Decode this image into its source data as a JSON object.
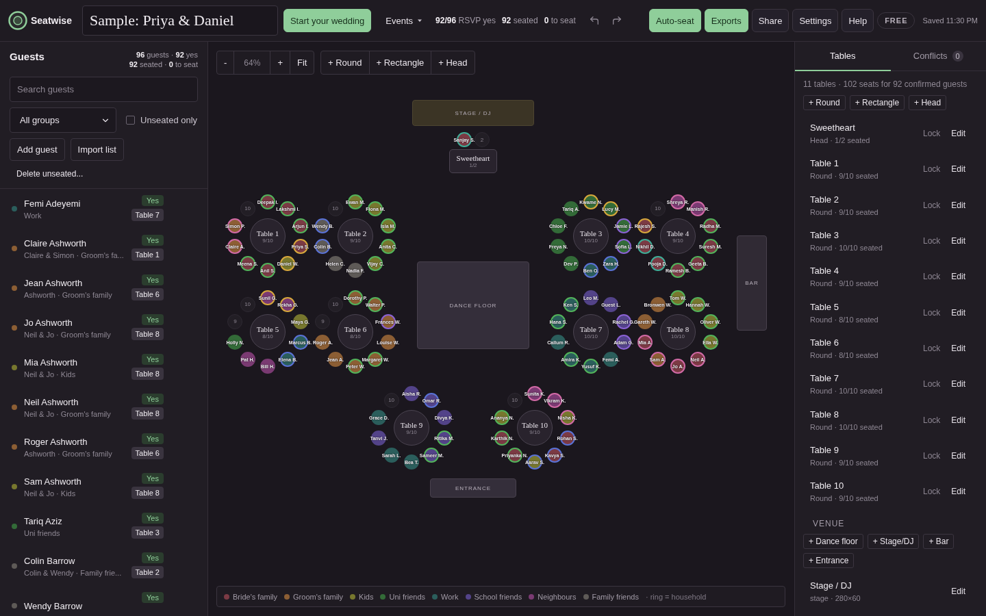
{
  "app": {
    "name": "Seatwise"
  },
  "title": "Sample: Priya & Daniel",
  "top_bar": {
    "start": "Start your wedding",
    "events": "Events",
    "stats": [
      "**92/96** RSVP yes",
      "**92** seated",
      "**0** to seat"
    ],
    "actions": [
      {
        "label": "Auto-seat",
        "kind": "primary"
      },
      {
        "label": "Exports",
        "kind": "primary"
      },
      {
        "label": "Share",
        "kind": "secondary"
      },
      {
        "label": "Settings",
        "kind": "secondary"
      },
      {
        "label": "Help",
        "kind": "secondary"
      }
    ],
    "plan": "FREE",
    "saved": "Saved 11:30 PM"
  },
  "guests_panel": {
    "title": "Guests",
    "stats": [
      "**96** guests · **92** yes",
      "**92** seated · **0** to seat"
    ],
    "search": {
      "placeholder": "Search guests"
    },
    "group_filter": "All groups",
    "unseated_only": {
      "label": "Unseated only",
      "checked": false
    },
    "buttons": [
      "Add guest",
      "Import list"
    ],
    "delete": "Delete unseated...",
    "guests": [
      {
        "name": "Femi Adeyemi",
        "detail": "Work",
        "rsvp": "Yes",
        "table": "Table 7",
        "color": "#2b5e5c"
      },
      {
        "name": "Claire Ashworth",
        "detail": "Claire & Simon · Groom's fa...",
        "rsvp": "Yes",
        "table": "Table 1",
        "color": "#8c5e34"
      },
      {
        "name": "Jean Ashworth",
        "detail": "Ashworth · Groom's family",
        "rsvp": "Yes",
        "table": "Table 6",
        "color": "#8c5e34"
      },
      {
        "name": "Jo Ashworth",
        "detail": "Neil & Jo · Groom's family",
        "rsvp": "Yes",
        "table": "Table 8",
        "color": "#8c5e34"
      },
      {
        "name": "Mia Ashworth",
        "detail": "Neil & Jo · Kids",
        "rsvp": "Yes",
        "table": "Table 8",
        "color": "#77772e"
      },
      {
        "name": "Neil Ashworth",
        "detail": "Neil & Jo · Groom's family",
        "rsvp": "Yes",
        "table": "Table 8",
        "color": "#8c5e34"
      },
      {
        "name": "Roger Ashworth",
        "detail": "Ashworth · Groom's family",
        "rsvp": "Yes",
        "table": "Table 6",
        "color": "#8c5e34"
      },
      {
        "name": "Sam Ashworth",
        "detail": "Neil & Jo · Kids",
        "rsvp": "Yes",
        "table": "Table 8",
        "color": "#77772e"
      },
      {
        "name": "Tariq Aziz",
        "detail": "Uni friends",
        "rsvp": "Yes",
        "table": "Table 3",
        "color": "#336b38"
      },
      {
        "name": "Colin Barrow",
        "detail": "Colin & Wendy · Family frie...",
        "rsvp": "Yes",
        "table": "Table 2",
        "color": "#5e5a57"
      },
      {
        "name": "Wendy Barrow",
        "rsvp": "Yes",
        "color": "#5e5a57"
      }
    ]
  },
  "canvas": {
    "zoom": {
      "minus": "-",
      "level_text": "64%",
      "plus": "+",
      "fit": "Fit"
    },
    "add_buttons": [
      "+ Round",
      "+ Rectangle",
      "+ Head"
    ],
    "venue": [
      {
        "label": "STAGE / DJ",
        "kind": "stage"
      },
      {
        "label": "DANCE FLOOR",
        "kind": "dance_floor"
      },
      {
        "label": "BAR",
        "kind": "bar"
      },
      {
        "label": "ENTRANCE",
        "kind": "entrance"
      }
    ],
    "tables": [
      {
        "name": "Sweetheart",
        "count": "1/2",
        "kind": "head",
        "seats": [
          {
            "name": "Sanjay S.",
            "color": "#7b3a44",
            "ring": {
              "color": "#3fae98"
            }
          },
          {
            "name": "2",
            "kind": "empty"
          }
        ]
      },
      {
        "name": "Table 1",
        "count": "9/10",
        "kind": "round",
        "seats": [
          {
            "name": "Deepak I.",
            "color": "#7b3a44",
            "ring": {
              "color": "#52b35a"
            }
          },
          {
            "name": "10",
            "kind": "empty"
          },
          {
            "name": "Lakshmi I.",
            "color": "#7b3a44",
            "ring": {
              "color": "#52b35a"
            }
          },
          {
            "name": "Simon P.",
            "color": "#8c5e34",
            "ring": {
              "color": "#d26aa6"
            }
          },
          {
            "name": "Arjun I.",
            "color": "#7b3a44",
            "ring": {
              "color": "#52b35a"
            }
          },
          {
            "name": "Claire A.",
            "color": "#8c5e34",
            "ring": {
              "color": "#d26aa6"
            }
          },
          {
            "name": "Priya S.",
            "color": "#7b3a44",
            "ring": {
              "color": "#d7a83c"
            }
          },
          {
            "name": "Meena S.",
            "color": "#7b3a44",
            "ring": {
              "color": "#52b35a"
            }
          },
          {
            "name": "Daniel W.",
            "color": "#77772e",
            "ring": {
              "color": "#d7a83c"
            }
          },
          {
            "name": "Anil S.",
            "color": "#7b3a44",
            "ring": {
              "color": "#52b35a"
            }
          }
        ]
      },
      {
        "name": "Table 2",
        "count": "9/10",
        "kind": "round",
        "seats": [
          {
            "name": "Ewan M.",
            "color": "#77772e",
            "ring": {
              "color": "#52b35a"
            }
          },
          {
            "name": "10",
            "kind": "empty"
          },
          {
            "name": "Fiona M.",
            "color": "#77772e",
            "ring": {
              "color": "#52b35a"
            }
          },
          {
            "name": "Wendy B.",
            "color": "#5e5a57",
            "ring": {
              "color": "#5a72d6"
            }
          },
          {
            "name": "Isla M.",
            "color": "#77772e",
            "ring": {
              "color": "#52b35a"
            }
          },
          {
            "name": "Colin B.",
            "color": "#5e5a57",
            "ring": {
              "color": "#5a72d6"
            }
          },
          {
            "name": "Anita C.",
            "color": "#77772e",
            "ring": {
              "color": "#52b35a"
            }
          },
          {
            "name": "Helen C.",
            "color": "#5e5a57"
          },
          {
            "name": "Vijay C.",
            "color": "#77772e",
            "ring": {
              "color": "#52b35a"
            }
          },
          {
            "name": "Nadia F.",
            "color": "#5e5a57"
          }
        ]
      },
      {
        "name": "Table 3",
        "count": "10/10",
        "kind": "round",
        "seats": [
          {
            "name": "Kwame N.",
            "color": "#336b38",
            "ring": {
              "color": "#d7a83c"
            }
          },
          {
            "name": "Tariq A.",
            "color": "#336b38"
          },
          {
            "name": "Lucy M.",
            "color": "#336b38",
            "ring": {
              "color": "#d7a83c"
            }
          },
          {
            "name": "Chloe F.",
            "color": "#336b38"
          },
          {
            "name": "Jamie L.",
            "color": "#336b38",
            "ring": {
              "color": "#8b62d4"
            }
          },
          {
            "name": "Freya N.",
            "color": "#336b38"
          },
          {
            "name": "Sofia L.",
            "color": "#336b38",
            "ring": {
              "color": "#8b62d4"
            }
          },
          {
            "name": "Dev P.",
            "color": "#336b38"
          },
          {
            "name": "Zara H.",
            "color": "#2b5e5c",
            "ring": {
              "color": "#5a72d6"
            }
          },
          {
            "name": "Ben O.",
            "color": "#2b5e5c",
            "ring": {
              "color": "#5a72d6"
            }
          }
        ]
      },
      {
        "name": "Table 4",
        "count": "9/10",
        "kind": "round",
        "seats": [
          {
            "name": "Shreya R.",
            "color": "#7a3a72",
            "ring": {
              "color": "#d26aa6"
            }
          },
          {
            "name": "10",
            "kind": "empty"
          },
          {
            "name": "Manish R.",
            "color": "#7a3a72",
            "ring": {
              "color": "#d26aa6"
            }
          },
          {
            "name": "Rajesh S.",
            "color": "#7b3a44",
            "ring": {
              "color": "#d7a83c"
            }
          },
          {
            "name": "Radha M.",
            "color": "#7b3a44",
            "ring": {
              "color": "#52b35a"
            }
          },
          {
            "name": "Nikhil D.",
            "color": "#7b3a44",
            "ring": {
              "color": "#3fae98"
            }
          },
          {
            "name": "Suresh M.",
            "color": "#7b3a44",
            "ring": {
              "color": "#52b35a"
            }
          },
          {
            "name": "Pooja D.",
            "color": "#7b3a44",
            "ring": {
              "color": "#3fae98"
            }
          },
          {
            "name": "Geeta B.",
            "color": "#7b3a44",
            "ring": {
              "color": "#52b35a"
            }
          },
          {
            "name": "Ramesh B.",
            "color": "#7b3a44",
            "ring": {
              "color": "#52b35a"
            }
          }
        ]
      },
      {
        "name": "Table 5",
        "count": "8/10",
        "kind": "round",
        "seats": [
          {
            "name": "Sunil G.",
            "color": "#7a3a72",
            "ring": {
              "color": "#d7a83c"
            }
          },
          {
            "name": "10",
            "kind": "empty"
          },
          {
            "name": "Rekha G.",
            "color": "#7a3a72",
            "ring": {
              "color": "#d7a83c"
            }
          },
          {
            "name": "9",
            "kind": "empty"
          },
          {
            "name": "Maya G.",
            "color": "#77772e"
          },
          {
            "name": "Holly N.",
            "color": "#336b38"
          },
          {
            "name": "Marcus B.",
            "color": "#2b5e5c",
            "ring": {
              "color": "#5a72d6"
            }
          },
          {
            "name": "Pat H.",
            "color": "#7a3a72"
          },
          {
            "name": "Elena B.",
            "color": "#2b5e5c",
            "ring": {
              "color": "#5a72d6"
            }
          },
          {
            "name": "Bill H.",
            "color": "#7a3a72"
          }
        ]
      },
      {
        "name": "Table 6",
        "count": "8/10",
        "kind": "round",
        "seats": [
          {
            "name": "Dorothy P.",
            "color": "#8c5e34",
            "ring": {
              "color": "#52b35a"
            }
          },
          {
            "name": "10",
            "kind": "empty"
          },
          {
            "name": "Walter P.",
            "color": "#8c5e34",
            "ring": {
              "color": "#52b35a"
            }
          },
          {
            "name": "9",
            "kind": "empty"
          },
          {
            "name": "Frances W.",
            "color": "#8c5e34",
            "ring": {
              "color": "#8b62d4"
            }
          },
          {
            "name": "Roger A.",
            "color": "#8c5e34"
          },
          {
            "name": "Louise W.",
            "color": "#8c5e34"
          },
          {
            "name": "Jean A.",
            "color": "#8c5e34"
          },
          {
            "name": "Margaret W.",
            "color": "#8c5e34",
            "ring": {
              "color": "#52b35a"
            }
          },
          {
            "name": "Peter W.",
            "color": "#8c5e34",
            "ring": {
              "color": "#52b35a"
            }
          }
        ]
      },
      {
        "name": "Table 7",
        "count": "10/10",
        "kind": "round",
        "seats": [
          {
            "name": "Leo M.",
            "color": "#534389"
          },
          {
            "name": "Ken S.",
            "color": "#2b5e5c",
            "ring": {
              "color": "#52b35a"
            }
          },
          {
            "name": "Guest L.",
            "color": "#534389"
          },
          {
            "name": "Hana S.",
            "color": "#2b5e5c",
            "ring": {
              "color": "#52b35a"
            }
          },
          {
            "name": "Rachel G.",
            "color": "#534389",
            "ring": {
              "color": "#8b62d4"
            }
          },
          {
            "name": "Callum R.",
            "color": "#2b5e5c"
          },
          {
            "name": "Adam G.",
            "color": "#534389",
            "ring": {
              "color": "#8b62d4"
            }
          },
          {
            "name": "Amira K.",
            "color": "#2b5e5c",
            "ring": {
              "color": "#52b35a"
            }
          },
          {
            "name": "Femi A.",
            "color": "#2b5e5c"
          },
          {
            "name": "Yusuf K.",
            "color": "#2b5e5c",
            "ring": {
              "color": "#52b35a"
            }
          }
        ]
      },
      {
        "name": "Table 8",
        "count": "10/10",
        "kind": "round",
        "seats": [
          {
            "name": "Tom W.",
            "color": "#77772e",
            "ring": {
              "color": "#52b35a"
            }
          },
          {
            "name": "Bronwen W.",
            "color": "#8c5e34"
          },
          {
            "name": "Hannah W.",
            "color": "#77772e",
            "ring": {
              "color": "#52b35a"
            }
          },
          {
            "name": "Gareth W.",
            "color": "#8c5e34"
          },
          {
            "name": "Oliver W.",
            "color": "#77772e",
            "ring": {
              "color": "#52b35a"
            }
          },
          {
            "name": "Mia A.",
            "color": "#7b3a44",
            "ring": {
              "color": "#d26aa6"
            }
          },
          {
            "name": "Ella W.",
            "color": "#77772e",
            "ring": {
              "color": "#52b35a"
            }
          },
          {
            "name": "Sam A.",
            "color": "#8c5e34",
            "ring": {
              "color": "#d26aa6"
            }
          },
          {
            "name": "Neil A.",
            "color": "#7b3a44",
            "ring": {
              "color": "#d26aa6"
            }
          },
          {
            "name": "Jo A.",
            "color": "#7b3a44",
            "ring": {
              "color": "#d26aa6"
            }
          }
        ]
      },
      {
        "name": "Table 9",
        "count": "9/10",
        "kind": "round",
        "seats": [
          {
            "name": "Aisha R.",
            "color": "#534389"
          },
          {
            "name": "10",
            "kind": "empty"
          },
          {
            "name": "Omar R.",
            "color": "#534389",
            "ring": {
              "color": "#5a72d6"
            }
          },
          {
            "name": "Grace D.",
            "color": "#2b5e5c"
          },
          {
            "name": "Divya K.",
            "color": "#534389"
          },
          {
            "name": "Tanvi J.",
            "color": "#534389"
          },
          {
            "name": "Ritika M.",
            "color": "#534389",
            "ring": {
              "color": "#52b35a"
            }
          },
          {
            "name": "Sarah L.",
            "color": "#2b5e5c"
          },
          {
            "name": "Sameer M.",
            "color": "#534389",
            "ring": {
              "color": "#52b35a"
            }
          },
          {
            "name": "Bea T.",
            "color": "#2b5e5c"
          }
        ]
      },
      {
        "name": "Table 10",
        "count": "9/10",
        "kind": "round",
        "seats": [
          {
            "name": "Sunita K.",
            "color": "#7a3a72",
            "ring": {
              "color": "#d26aa6"
            }
          },
          {
            "name": "10",
            "kind": "empty"
          },
          {
            "name": "Vikram K.",
            "color": "#7a3a72",
            "ring": {
              "color": "#d26aa6"
            }
          },
          {
            "name": "Ananya N.",
            "color": "#77772e",
            "ring": {
              "color": "#52b35a"
            }
          },
          {
            "name": "Nisha K.",
            "color": "#77772e",
            "ring": {
              "color": "#d26aa6"
            }
          },
          {
            "name": "Karthik N.",
            "color": "#7b3a44",
            "ring": {
              "color": "#52b35a"
            }
          },
          {
            "name": "Rohan S.",
            "color": "#7b3a44",
            "ring": {
              "color": "#5a72d6"
            }
          },
          {
            "name": "Priyanka N.",
            "color": "#7b3a44",
            "ring": {
              "color": "#52b35a"
            }
          },
          {
            "name": "Kavya S.",
            "color": "#7b3a44",
            "ring": {
              "color": "#5a72d6"
            }
          },
          {
            "name": "Aarav S.",
            "color": "#77772e",
            "ring": {
              "color": "#5a72d6"
            }
          }
        ]
      }
    ],
    "legend": {
      "items": [
        {
          "label": "Bride's family",
          "color": "#7b3a44"
        },
        {
          "label": "Groom's family",
          "color": "#8c5e34"
        },
        {
          "label": "Kids",
          "color": "#77772e"
        },
        {
          "label": "Uni friends",
          "color": "#336b38"
        },
        {
          "label": "Work",
          "color": "#2b5e5c"
        },
        {
          "label": "School friends",
          "color": "#534389"
        },
        {
          "label": "Neighbours",
          "color": "#7a3a72"
        },
        {
          "label": "Family friends",
          "color": "#5e5a57"
        }
      ],
      "note": "· ring = household"
    }
  },
  "side_panel": {
    "tabs": [
      {
        "label": "Tables",
        "selected": true
      },
      {
        "label": "Conflicts",
        "count": "0",
        "selected": false
      }
    ],
    "summary": "11 tables · 102 seats for 92 confirmed guests",
    "add_buttons": [
      "+ Round",
      "+ Rectangle",
      "+ Head"
    ],
    "tables": [
      {
        "name": "Sweetheart",
        "detail": "Head · 1/2 seated",
        "actions": [
          "Lock",
          "Edit"
        ]
      },
      {
        "name": "Table 1",
        "detail": "Round · 9/10 seated",
        "actions": [
          "Lock",
          "Edit"
        ]
      },
      {
        "name": "Table 2",
        "detail": "Round · 9/10 seated",
        "actions": [
          "Lock",
          "Edit"
        ]
      },
      {
        "name": "Table 3",
        "detail": "Round · 10/10 seated",
        "actions": [
          "Lock",
          "Edit"
        ]
      },
      {
        "name": "Table 4",
        "detail": "Round · 9/10 seated",
        "actions": [
          "Lock",
          "Edit"
        ]
      },
      {
        "name": "Table 5",
        "detail": "Round · 8/10 seated",
        "actions": [
          "Lock",
          "Edit"
        ]
      },
      {
        "name": "Table 6",
        "detail": "Round · 8/10 seated",
        "actions": [
          "Lock",
          "Edit"
        ]
      },
      {
        "name": "Table 7",
        "detail": "Round · 10/10 seated",
        "actions": [
          "Lock",
          "Edit"
        ]
      },
      {
        "name": "Table 8",
        "detail": "Round · 10/10 seated",
        "actions": [
          "Lock",
          "Edit"
        ]
      },
      {
        "name": "Table 9",
        "detail": "Round · 9/10 seated",
        "actions": [
          "Lock",
          "Edit"
        ]
      },
      {
        "name": "Table 10",
        "detail": "Round · 9/10 seated",
        "actions": [
          "Lock",
          "Edit"
        ]
      }
    ],
    "venue_heading": "VENUE",
    "venue_buttons": [
      "+ Dance floor",
      "+ Stage/DJ",
      "+ Bar",
      "+ Entrance"
    ],
    "venue_items": [
      {
        "name": "Stage / DJ",
        "detail": "stage · 280×60",
        "actions": [
          "Edit"
        ]
      }
    ]
  }
}
